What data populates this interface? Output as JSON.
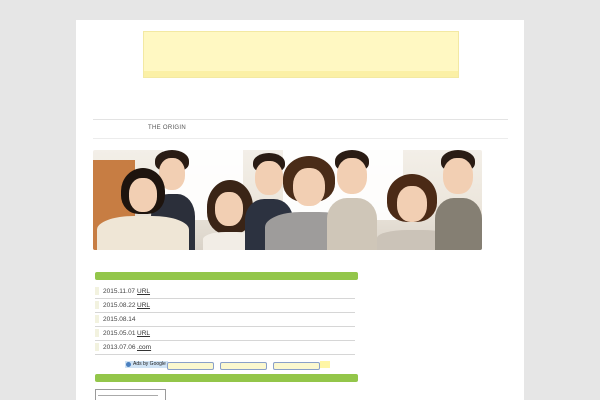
{
  "site": {
    "brand": "THE ORIGIN"
  },
  "news": [
    {
      "date": "2015.11.07",
      "link": "URL"
    },
    {
      "date": "2015.08.22",
      "link": "URL"
    },
    {
      "date": "2015.08.14",
      "link": ""
    },
    {
      "date": "2015.05.01",
      "link": "URL"
    },
    {
      "date": "2013.07.06",
      "link": ".com"
    }
  ],
  "ads": {
    "label": "Ads by Google",
    "buttons": [
      "",
      "",
      ""
    ]
  },
  "colors": {
    "background": "#e6e6e6",
    "banner": "#fff8c2",
    "accent": "#93c64a"
  },
  "icons": [
    "adchoices-icon"
  ]
}
